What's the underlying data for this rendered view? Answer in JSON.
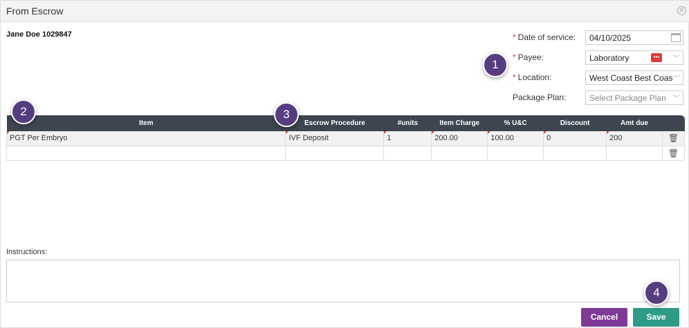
{
  "dialog": {
    "title": "From Escrow",
    "close_icon": "close-circle-icon"
  },
  "patient": "Jane Doe 1029847",
  "form": {
    "date_label": "Date of service:",
    "date_value": "04/10/2025",
    "payee_label": "Payee:",
    "payee_value": "Laboratory",
    "location_label": "Location:",
    "location_value": "West Coast Best Coast",
    "package_label": "Package Plan:",
    "package_placeholder": "Select Package Plan",
    "required_mark": "*"
  },
  "table": {
    "headers": [
      "Item",
      "Escrow Procedure",
      "#units",
      "Item Charge",
      "% U&C",
      "Discount",
      "Amt due"
    ],
    "rows": [
      {
        "item": "PGT Per Embryo",
        "procedure": "IVF Deposit",
        "units": "1",
        "charge": "200.00",
        "uc": "100.00",
        "discount": "0",
        "amt": "200"
      },
      {
        "item": "",
        "procedure": "",
        "units": "",
        "charge": "",
        "uc": "",
        "discount": "",
        "amt": ""
      }
    ]
  },
  "instructions": {
    "label": "Instructions:",
    "value": ""
  },
  "buttons": {
    "cancel": "Cancel",
    "save": "Save"
  },
  "badges": [
    "1",
    "2",
    "3",
    "4"
  ],
  "colors": {
    "header": "#3d4550",
    "cancel": "#7e3a96",
    "save": "#2e9b86",
    "badge": "#553d7f"
  }
}
